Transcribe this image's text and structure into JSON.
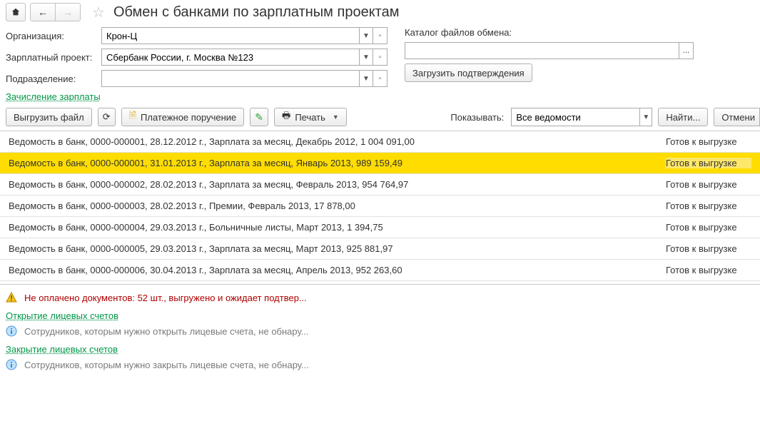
{
  "header": {
    "title": "Обмен с банками по зарплатным проектам"
  },
  "form": {
    "org_label": "Организация:",
    "org_value": "Крон-Ц",
    "project_label": "Зарплатный проект:",
    "project_value": "Сбербанк России, г. Москва №123",
    "dept_label": "Подразделение:",
    "dept_value": "",
    "catalog_label": "Каталог файлов обмена:",
    "catalog_value": "",
    "load_confirm": "Загрузить подтверждения"
  },
  "links": {
    "payroll_credit": "Зачисление зарплаты",
    "open_accounts": "Открытие лицевых счетов",
    "close_accounts": "Закрытие лицевых счетов"
  },
  "toolbar": {
    "export_file": "Выгрузить файл",
    "payment_order": "Платежное поручение",
    "print": "Печать",
    "show_label": "Показывать:",
    "show_value": "Все ведомости",
    "find": "Найти...",
    "cancel": "Отмени"
  },
  "rows": [
    {
      "desc": "Ведомость в банк, 0000-000001, 28.12.2012 г., Зарплата за месяц, Декабрь 2012, 1 004 091,00",
      "status": "Готов к выгрузке",
      "selected": false
    },
    {
      "desc": "Ведомость в банк, 0000-000001, 31.01.2013 г., Зарплата за месяц, Январь 2013, 989 159,49",
      "status": "Готов к выгрузке",
      "selected": true
    },
    {
      "desc": "Ведомость в банк, 0000-000002, 28.02.2013 г., Зарплата за месяц, Февраль 2013, 954 764,97",
      "status": "Готов к выгрузке",
      "selected": false
    },
    {
      "desc": "Ведомость в банк, 0000-000003, 28.02.2013 г., Премии, Февраль 2013, 17 878,00",
      "status": "Готов к выгрузке",
      "selected": false
    },
    {
      "desc": "Ведомость в банк, 0000-000004, 29.03.2013 г., Больничные листы, Март 2013, 1 394,75",
      "status": "Готов к выгрузке",
      "selected": false
    },
    {
      "desc": "Ведомость в банк, 0000-000005, 29.03.2013 г., Зарплата за месяц, Март 2013, 925 881,97",
      "status": "Готов к выгрузке",
      "selected": false
    },
    {
      "desc": "Ведомость в банк, 0000-000006, 30.04.2013 г., Зарплата за месяц, Апрель 2013, 952 263,60",
      "status": "Готов к выгрузке",
      "selected": false
    }
  ],
  "footer": {
    "unpaid_warning": "Не оплачено документов: 52 шт., выгружено и ожидает подтвер...",
    "open_none": "Сотрудников, которым нужно открыть лицевые счета, не обнару...",
    "close_none": "Сотрудников, которым нужно закрыть лицевые счета, не обнару..."
  }
}
